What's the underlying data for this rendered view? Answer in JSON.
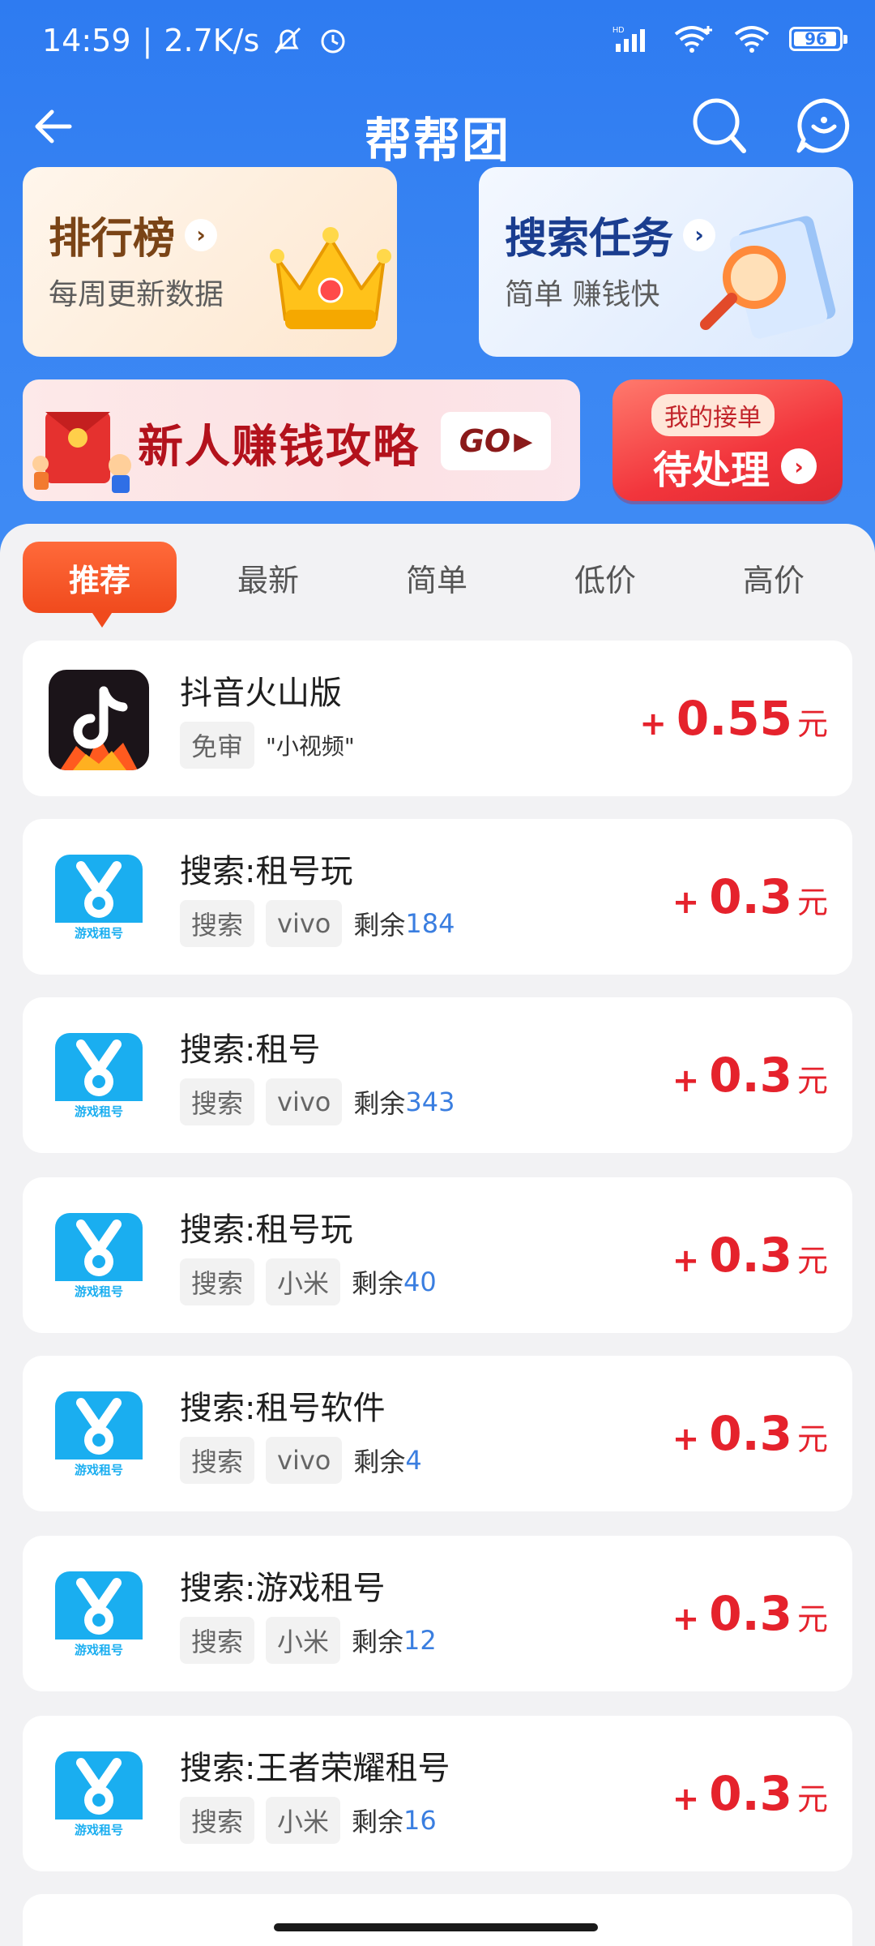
{
  "status_bar": {
    "time": "14:59",
    "net_speed": "2.7K/s",
    "battery": "96",
    "battery_level": 0.96
  },
  "header": {
    "title": "帮帮团"
  },
  "feature_cards": {
    "rank": {
      "title": "排行榜",
      "subtitle": "每周更新数据"
    },
    "search": {
      "title": "搜索任务",
      "subtitle": "简单  赚钱快"
    }
  },
  "promo": {
    "text": "新人赚钱攻略",
    "go_label": "GO",
    "pending_top": "我的接单",
    "pending_main": "待处理"
  },
  "tabs": [
    {
      "label": "推荐",
      "active": true
    },
    {
      "label": "最新",
      "active": false
    },
    {
      "label": "简单",
      "active": false
    },
    {
      "label": "低价",
      "active": false
    },
    {
      "label": "高价",
      "active": false
    }
  ],
  "tasks": [
    {
      "name": "抖音火山版",
      "icon": "douyin-huoshan-icon",
      "tags": [
        "免审"
      ],
      "extra_tag": "\"小视频\"",
      "remain_label": "",
      "remain": "",
      "price_prefix": "+",
      "price": "0.55",
      "unit": "元"
    },
    {
      "name": "搜索:租号玩",
      "icon": "game-rental-icon",
      "tags": [
        "搜索",
        "vivo"
      ],
      "extra_tag": "",
      "remain_label": "剩余",
      "remain": "184",
      "price_prefix": "+",
      "price": "0.3",
      "unit": "元"
    },
    {
      "name": "搜索:租号",
      "icon": "game-rental-icon",
      "tags": [
        "搜索",
        "vivo"
      ],
      "extra_tag": "",
      "remain_label": "剩余",
      "remain": "343",
      "price_prefix": "+",
      "price": "0.3",
      "unit": "元"
    },
    {
      "name": "搜索:租号玩",
      "icon": "game-rental-icon",
      "tags": [
        "搜索",
        "小米"
      ],
      "extra_tag": "",
      "remain_label": "剩余",
      "remain": "40",
      "price_prefix": "+",
      "price": "0.3",
      "unit": "元"
    },
    {
      "name": "搜索:租号软件",
      "icon": "game-rental-icon",
      "tags": [
        "搜索",
        "vivo"
      ],
      "extra_tag": "",
      "remain_label": "剩余",
      "remain": "4",
      "price_prefix": "+",
      "price": "0.3",
      "unit": "元"
    },
    {
      "name": "搜索:游戏租号",
      "icon": "game-rental-icon",
      "tags": [
        "搜索",
        "小米"
      ],
      "extra_tag": "",
      "remain_label": "剩余",
      "remain": "12",
      "price_prefix": "+",
      "price": "0.3",
      "unit": "元"
    },
    {
      "name": "搜索:王者荣耀租号",
      "icon": "game-rental-icon",
      "tags": [
        "搜索",
        "小米"
      ],
      "extra_tag": "",
      "remain_label": "剩余",
      "remain": "16",
      "price_prefix": "+",
      "price": "0.3",
      "unit": "元"
    }
  ],
  "game_icon_label": "游戏租号",
  "colors": {
    "header_blue": "#2e7bf1",
    "price_red": "#e5222c",
    "tab_active": "#f04a1d",
    "remain_blue": "#3a7ee0"
  }
}
